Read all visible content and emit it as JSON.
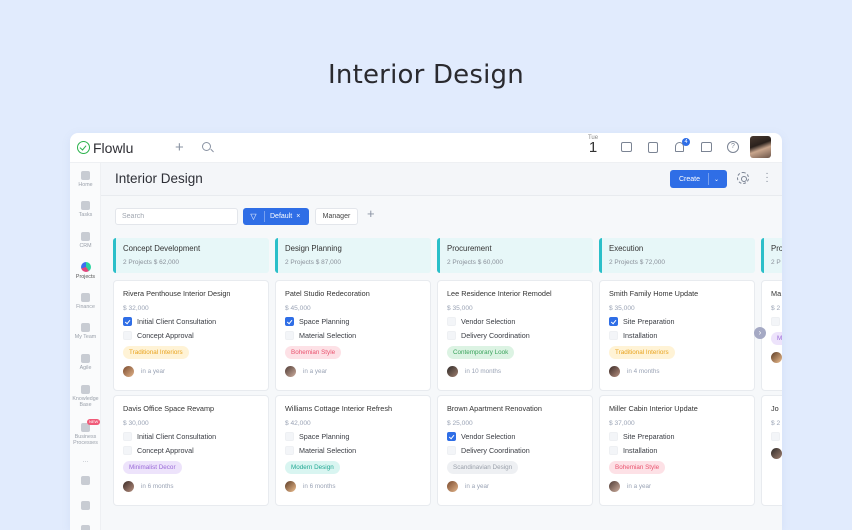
{
  "hero": {
    "title": "Interior Design"
  },
  "topbar": {
    "logo_text": "Flowlu",
    "date_dow": "Tue",
    "date_day": "1",
    "notification_count": "4",
    "help_label": "?"
  },
  "sidebar": {
    "items": [
      {
        "label": "Home"
      },
      {
        "label": "Tasks"
      },
      {
        "label": "CRM"
      },
      {
        "label": "Projects"
      },
      {
        "label": "Finance"
      },
      {
        "label": "My Team"
      },
      {
        "label": "Agile"
      },
      {
        "label": "Knowledge Base"
      },
      {
        "label": "Business Processes",
        "badge": "NEW"
      }
    ],
    "more_label": "..."
  },
  "header": {
    "title": "Interior Design",
    "create_label": "Create"
  },
  "toolbar": {
    "search_placeholder": "Search",
    "filter_label": "Default",
    "manager_label": "Manager"
  },
  "columns": [
    {
      "title": "Concept Development",
      "meta": "2 Projects   $ 62,000",
      "cards": [
        {
          "title": "Rivera Penthouse Interior Design",
          "amount": "$ 32,000",
          "tasks": [
            {
              "label": "Initial Client Consultation",
              "checked": true
            },
            {
              "label": "Concept Approval",
              "checked": false
            }
          ],
          "tag": {
            "label": "Traditional Interiors",
            "bg": "#fff3d6",
            "fg": "#e8a31f"
          },
          "due": "in a year"
        },
        {
          "title": "Davis Office Space Revamp",
          "amount": "$ 30,000",
          "tasks": [
            {
              "label": "Initial Client Consultation",
              "checked": false
            },
            {
              "label": "Concept Approval",
              "checked": false
            }
          ],
          "tag": {
            "label": "Minimalist Decor",
            "bg": "#ede3fb",
            "fg": "#9a68d8"
          },
          "due": "in 6 months"
        }
      ]
    },
    {
      "title": "Design Planning",
      "meta": "2 Projects   $ 87,000",
      "cards": [
        {
          "title": "Patel Studio Redecoration",
          "amount": "$ 45,000",
          "tasks": [
            {
              "label": "Space Planning",
              "checked": true
            },
            {
              "label": "Material Selection",
              "checked": false
            }
          ],
          "tag": {
            "label": "Bohemian Style",
            "bg": "#fde1e6",
            "fg": "#e9536f"
          },
          "due": "in a year"
        },
        {
          "title": "Williams Cottage Interior Refresh",
          "amount": "$ 42,000",
          "tasks": [
            {
              "label": "Space Planning",
              "checked": false
            },
            {
              "label": "Material Selection",
              "checked": false
            }
          ],
          "tag": {
            "label": "Modern Design",
            "bg": "#d9f5f1",
            "fg": "#22a893"
          },
          "due": "in 6 months"
        }
      ]
    },
    {
      "title": "Procurement",
      "meta": "2 Projects   $ 60,000",
      "cards": [
        {
          "title": "Lee Residence Interior Remodel",
          "amount": "$ 35,000",
          "tasks": [
            {
              "label": "Vendor Selection",
              "checked": false
            },
            {
              "label": "Delivery Coordination",
              "checked": false
            }
          ],
          "tag": {
            "label": "Contemporary Look",
            "bg": "#dcf3e3",
            "fg": "#3aa35c"
          },
          "due": "in 10 months"
        },
        {
          "title": "Brown Apartment Renovation",
          "amount": "$ 25,000",
          "tasks": [
            {
              "label": "Vendor Selection",
              "checked": true
            },
            {
              "label": "Delivery Coordination",
              "checked": false
            }
          ],
          "tag": {
            "label": "Scandinavian Design",
            "bg": "#eef0f3",
            "fg": "#9aa0aa"
          },
          "due": "in a year"
        }
      ]
    },
    {
      "title": "Execution",
      "meta": "2 Projects   $ 72,000",
      "cards": [
        {
          "title": "Smith Family Home Update",
          "amount": "$ 35,000",
          "tasks": [
            {
              "label": "Site Preparation",
              "checked": true
            },
            {
              "label": "Installation",
              "checked": false
            }
          ],
          "tag": {
            "label": "Traditional Interiors",
            "bg": "#fff3d6",
            "fg": "#e8a31f"
          },
          "due": "in 4 months"
        },
        {
          "title": "Miller Cabin Interior Update",
          "amount": "$ 37,000",
          "tasks": [
            {
              "label": "Site Preparation",
              "checked": false
            },
            {
              "label": "Installation",
              "checked": false
            }
          ],
          "tag": {
            "label": "Bohemian Style",
            "bg": "#fde1e6",
            "fg": "#e9536f"
          },
          "due": "in a year"
        }
      ]
    },
    {
      "title": "Pro",
      "meta": "2 P",
      "cards": [
        {
          "title": "Ma",
          "amount": "$ 2",
          "tasks": [
            {
              "label": "",
              "checked": false
            }
          ],
          "tag": {
            "label": "M",
            "bg": "#ede3fb",
            "fg": "#9a68d8"
          },
          "due": ""
        },
        {
          "title": "Jo",
          "amount": "$ 2",
          "tasks": [
            {
              "label": "",
              "checked": false
            }
          ],
          "tag": null,
          "due": ""
        }
      ]
    }
  ],
  "colors": {
    "accent": "#2f6ee6",
    "column_stripe": "#2bbfc9",
    "column_bg": "#e7f7f8",
    "page_bg": "#e1ebfd"
  }
}
